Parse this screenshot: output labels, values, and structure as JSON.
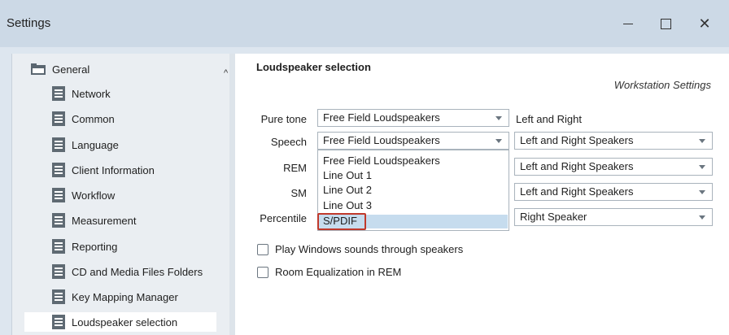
{
  "window": {
    "title": "Settings"
  },
  "sidebar": {
    "items": [
      {
        "label": "General",
        "icon": "folder-icon"
      },
      {
        "label": "Network",
        "icon": "document-icon"
      },
      {
        "label": "Common",
        "icon": "document-icon"
      },
      {
        "label": "Language",
        "icon": "document-icon"
      },
      {
        "label": "Client Information",
        "icon": "document-icon"
      },
      {
        "label": "Workflow",
        "icon": "document-icon"
      },
      {
        "label": "Measurement",
        "icon": "document-icon"
      },
      {
        "label": "Reporting",
        "icon": "document-icon"
      },
      {
        "label": "CD and Media Files Folders",
        "icon": "document-icon"
      },
      {
        "label": "Key Mapping Manager",
        "icon": "document-icon"
      },
      {
        "label": "Loudspeaker selection",
        "icon": "document-icon"
      }
    ],
    "selected": "Loudspeaker selection"
  },
  "content": {
    "section_title": "Loudspeaker selection",
    "scope_label": "Workstation Settings",
    "rows": [
      {
        "label": "Pure tone",
        "source": "Free Field Loudspeakers",
        "output": "Left and Right",
        "output_is_dropdown": false
      },
      {
        "label": "Speech",
        "source": "Free Field Loudspeakers",
        "output": "Left and Right Speakers",
        "output_is_dropdown": true
      },
      {
        "label": "REM",
        "output": "Left and Right Speakers"
      },
      {
        "label": "SM",
        "output": "Left and Right Speakers"
      },
      {
        "label": "Percentile",
        "output": "Right Speaker"
      }
    ],
    "dropdown": {
      "options": [
        "Free Field Loudspeakers",
        "Line Out 1",
        "Line Out 2",
        "Line Out 3",
        "S/PDIF"
      ],
      "highlighted": "S/PDIF"
    },
    "checkboxes": [
      {
        "label": "Play Windows sounds through speakers",
        "checked": false
      },
      {
        "label": "Room Equalization in REM",
        "checked": false
      }
    ]
  },
  "colors": {
    "titlebar": "#ccd9e6",
    "sidebar": "#eaeef2",
    "selection": "#c6dcee",
    "highlight_border": "#c0392b"
  }
}
